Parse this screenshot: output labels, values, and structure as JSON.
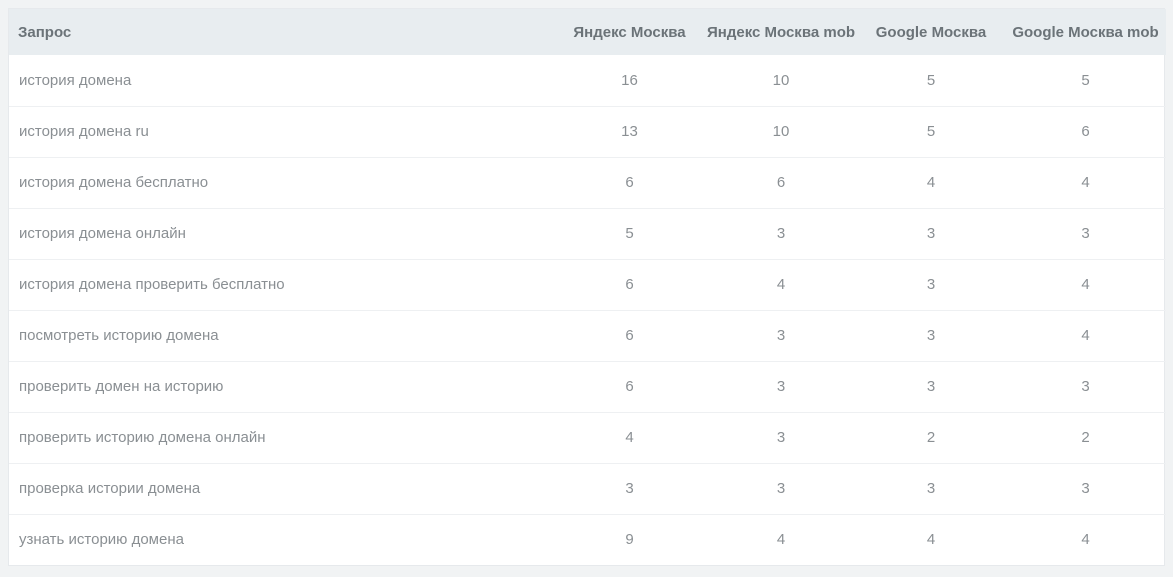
{
  "table": {
    "headers": [
      "Запрос",
      "Яндекс Москва",
      "Яндекс Москва mob",
      "Google Москва",
      "Google Москва mob"
    ],
    "rows": [
      {
        "query": "история домена",
        "yandex": "16",
        "yandex_mob": "10",
        "google": "5",
        "google_mob": "5"
      },
      {
        "query": "история домена ru",
        "yandex": "13",
        "yandex_mob": "10",
        "google": "5",
        "google_mob": "6"
      },
      {
        "query": "история домена бесплатно",
        "yandex": "6",
        "yandex_mob": "6",
        "google": "4",
        "google_mob": "4"
      },
      {
        "query": "история домена онлайн",
        "yandex": "5",
        "yandex_mob": "3",
        "google": "3",
        "google_mob": "3"
      },
      {
        "query": "история домена проверить бесплатно",
        "yandex": "6",
        "yandex_mob": "4",
        "google": "3",
        "google_mob": "4"
      },
      {
        "query": "посмотреть историю домена",
        "yandex": "6",
        "yandex_mob": "3",
        "google": "3",
        "google_mob": "4"
      },
      {
        "query": "проверить домен на историю",
        "yandex": "6",
        "yandex_mob": "3",
        "google": "3",
        "google_mob": "3"
      },
      {
        "query": "проверить историю домена онлайн",
        "yandex": "4",
        "yandex_mob": "3",
        "google": "2",
        "google_mob": "2"
      },
      {
        "query": "проверка истории домена",
        "yandex": "3",
        "yandex_mob": "3",
        "google": "3",
        "google_mob": "3"
      },
      {
        "query": "узнать историю домена",
        "yandex": "9",
        "yandex_mob": "4",
        "google": "4",
        "google_mob": "4"
      }
    ]
  }
}
